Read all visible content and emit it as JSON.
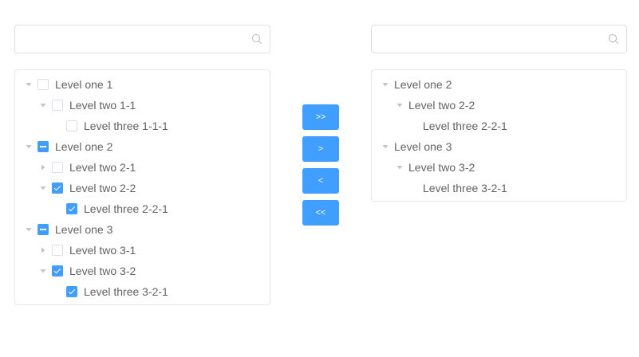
{
  "left_search": {
    "placeholder": "",
    "value": ""
  },
  "right_search": {
    "placeholder": "",
    "value": ""
  },
  "left_tree": [
    {
      "label": "Level one 1",
      "level": 1,
      "caret": "down",
      "check": "unchecked"
    },
    {
      "label": "Level two 1-1",
      "level": 2,
      "caret": "down",
      "check": "unchecked"
    },
    {
      "label": "Level three 1-1-1",
      "level": 3,
      "caret": "none",
      "check": "unchecked"
    },
    {
      "label": "Level one 2",
      "level": 1,
      "caret": "down",
      "check": "indeterminate"
    },
    {
      "label": "Level two 2-1",
      "level": 2,
      "caret": "right",
      "check": "unchecked"
    },
    {
      "label": "Level two 2-2",
      "level": 2,
      "caret": "down",
      "check": "checked"
    },
    {
      "label": "Level three 2-2-1",
      "level": 3,
      "caret": "none",
      "check": "checked"
    },
    {
      "label": "Level one 3",
      "level": 1,
      "caret": "down",
      "check": "indeterminate"
    },
    {
      "label": "Level two 3-1",
      "level": 2,
      "caret": "right",
      "check": "unchecked"
    },
    {
      "label": "Level two 3-2",
      "level": 2,
      "caret": "down",
      "check": "checked"
    },
    {
      "label": "Level three 3-2-1",
      "level": 3,
      "caret": "none",
      "check": "checked"
    }
  ],
  "right_tree": [
    {
      "label": "Level one 2",
      "level": 1,
      "caret": "down"
    },
    {
      "label": "Level two 2-2",
      "level": 2,
      "caret": "down"
    },
    {
      "label": "Level three 2-2-1",
      "level": 3,
      "caret": "none"
    },
    {
      "label": "Level one 3",
      "level": 1,
      "caret": "down"
    },
    {
      "label": "Level two 3-2",
      "level": 2,
      "caret": "down"
    },
    {
      "label": "Level three 3-2-1",
      "level": 3,
      "caret": "none"
    }
  ],
  "buttons": {
    "move_all_right": ">>",
    "move_right": ">",
    "move_left": "<",
    "move_all_left": "<<"
  },
  "colors": {
    "primary": "#409eff",
    "border": "#dcdfe6",
    "text": "#606266",
    "caret": "#c0c4cc"
  }
}
